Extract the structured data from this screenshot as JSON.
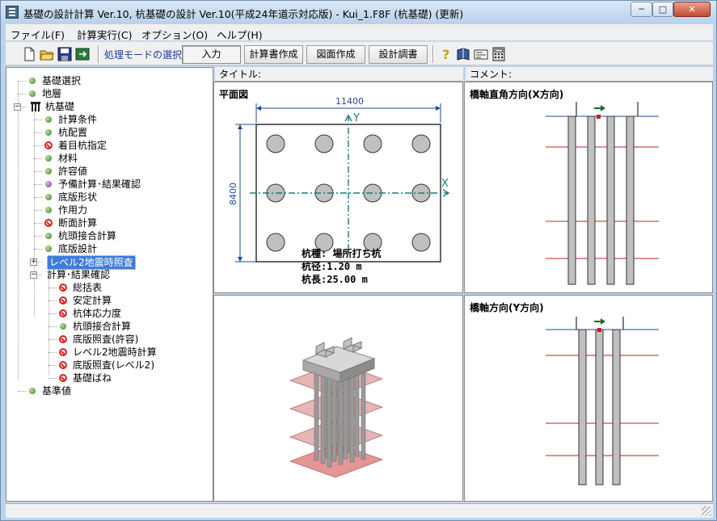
{
  "window": {
    "title": "基礎の設計計算 Ver.10, 杭基礎の設計 Ver.10(平成24年道示対応版) - Kui_1.F8F (杭基礎) (更新)",
    "controls": {
      "minimize": "─",
      "maximize": "□",
      "close": "✕"
    }
  },
  "menu": [
    "ファイル(F)",
    "計算実行(C)",
    "オプション(O)",
    "ヘルプ(H)"
  ],
  "toolbar": {
    "mode_label": "処理モードの選択",
    "buttons": [
      "入力",
      "計算書作成",
      "図面作成",
      "設計調書"
    ],
    "active_button": "入力",
    "left_icons": [
      "new-file-icon",
      "open-folder-icon",
      "save-icon",
      "export-icon"
    ],
    "right_icons": [
      "help-icon",
      "book-icon",
      "card-icon",
      "calculator-icon"
    ]
  },
  "tree": [
    {
      "label": "基礎選択",
      "icon": "ok"
    },
    {
      "label": "地層",
      "icon": "ok"
    },
    {
      "label": "杭基礎",
      "icon": "pile",
      "expanded": true
    },
    {
      "label": "計算条件",
      "icon": "ok"
    },
    {
      "label": "杭配置",
      "icon": "ok"
    },
    {
      "label": "着目杭指定",
      "icon": "no"
    },
    {
      "label": "材料",
      "icon": "ok"
    },
    {
      "label": "許容値",
      "icon": "ok"
    },
    {
      "label": "予備計算･結果確認",
      "icon": "purple"
    },
    {
      "label": "底版形状",
      "icon": "ok"
    },
    {
      "label": "作用力",
      "icon": "ok"
    },
    {
      "label": "断面計算",
      "icon": "no"
    },
    {
      "label": "杭頭接合計算",
      "icon": "ok"
    },
    {
      "label": "底版設計",
      "icon": "ok"
    },
    {
      "label": "レベル2地震時照査",
      "icon": "none",
      "selected": true,
      "collapsed": true
    },
    {
      "label": "計算･結果確認",
      "icon": "none",
      "expanded": true
    },
    {
      "label": "総括表",
      "icon": "no"
    },
    {
      "label": "安定計算",
      "icon": "no"
    },
    {
      "label": "杭体応力度",
      "icon": "no"
    },
    {
      "label": "杭頭接合計算",
      "icon": "ok"
    },
    {
      "label": "底版照査(許容)",
      "icon": "no"
    },
    {
      "label": "レベル2地震時計算",
      "icon": "no"
    },
    {
      "label": "底版照査(レベル2)",
      "icon": "no"
    },
    {
      "label": "基礎ばね",
      "icon": "no"
    },
    {
      "label": "基準値",
      "icon": "ok"
    }
  ],
  "headers": {
    "title": "タイトル:",
    "comment": "コメント:"
  },
  "plan": {
    "heading": "平面図",
    "width_dim": "11400",
    "height_dim": "8400",
    "axis_y": "Y",
    "axis_x": "X",
    "rows": 3,
    "cols": 4,
    "pile_type": "杭種: 場所打ち杭",
    "pile_diameter": "杭径:1.20 m",
    "pile_length": "杭長:25.00 m"
  },
  "section_x": {
    "heading": "橋軸直角方向(X方向)",
    "pile_count": 4
  },
  "section_y": {
    "heading": "橋軸方向(Y方向)",
    "pile_count": 3
  },
  "colors": {
    "dim_line": "#1a4aa0",
    "axis": "#1a7a7a",
    "layer_line": "#c02020",
    "pile_fill": "#c0c0c0",
    "selection": "#3f7cd9"
  }
}
